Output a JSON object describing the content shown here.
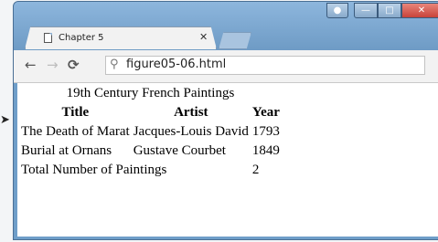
{
  "browser": {
    "tab_title": "Chapter 5",
    "url": "figure05-06.html"
  },
  "table": {
    "caption": "19th Century French Paintings",
    "headers": [
      "Title",
      "Artist",
      "Year"
    ],
    "rows": [
      [
        "The Death of Marat",
        "Jacques-Louis David",
        "1793"
      ],
      [
        "Burial at Ornans",
        "Gustave Courbet",
        "1849"
      ]
    ],
    "footer": {
      "label": "Total Number of Paintings",
      "count": "2"
    }
  }
}
